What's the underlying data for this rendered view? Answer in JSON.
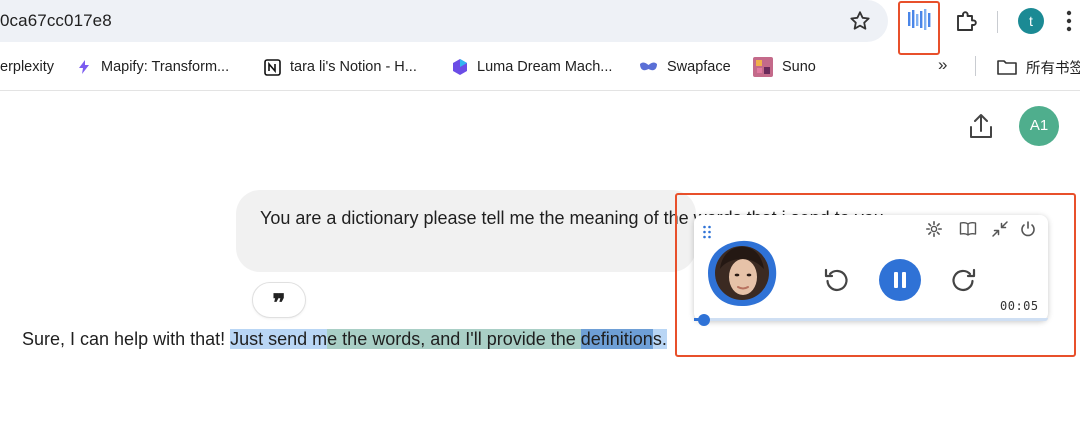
{
  "browser": {
    "url": "0ca67cc017e8",
    "profile_initial": "t",
    "bookmarks": [
      {
        "label": "erplexity",
        "icon": "perplexity-icon"
      },
      {
        "label": "Mapify: Transform...",
        "icon": "mapify-icon"
      },
      {
        "label": "tara li's Notion - H...",
        "icon": "notion-icon"
      },
      {
        "label": "Luma Dream Mach...",
        "icon": "luma-icon"
      },
      {
        "label": "Swapface",
        "icon": "swapface-icon"
      },
      {
        "label": "Suno",
        "icon": "suno-icon"
      }
    ],
    "overflow": "»",
    "all_bookmarks": "所有书签"
  },
  "page": {
    "avatar_initials": "A1",
    "user_message": "You are a dictionary please tell me the meaning of the words that i send to you",
    "quote_glyph": "❞",
    "reply": {
      "plain": "Sure, I can help with that! ",
      "hl1": "Just send m",
      "hl2": "e the words, and I'll provide the ",
      "hl3": "definition",
      "hl4": "s."
    }
  },
  "reader": {
    "time": "00:05",
    "progress": 0.03
  },
  "colors": {
    "accent": "#2f72d6",
    "frame": "#e8502b",
    "avatar": "#4fae8d"
  }
}
